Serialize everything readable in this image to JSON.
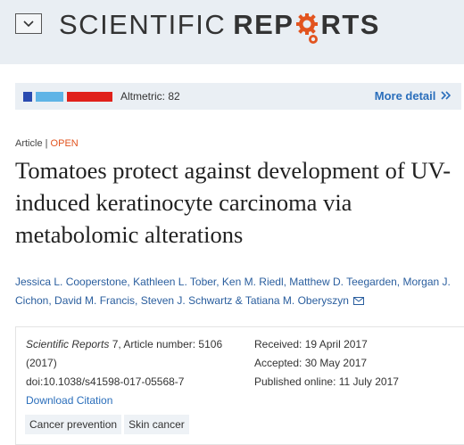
{
  "header": {
    "menu_icon": "chevron-down-icon",
    "logo_text_1": "SCIENTIFIC",
    "logo_text_2": "REP",
    "logo_text_3": "RTS"
  },
  "altmetric": {
    "label": "Altmetric: 82",
    "more_label": "More detail",
    "more_icon": "double-chevron-right-icon",
    "colors": [
      "#2a4bb0",
      "#5fb4e6",
      "#e0211b"
    ]
  },
  "article": {
    "type": "Article",
    "separator": "|",
    "access": "OPEN",
    "title": "Tomatoes protect against development of UV-induced keratinocyte carcinoma via metabolomic alterations",
    "authors_line1": "Jessica L. Cooperstone, Kathleen L. Tober, Ken M. Riedl, Matthew D. Teegarden, Morgan J.",
    "authors_line2": "Cichon, David M. Francis, Steven J. Schwartz & Tatiana M. Oberyszyn",
    "mail_icon": "envelope-icon"
  },
  "citation": {
    "journal": "Scientific Reports",
    "volume": " 7",
    "article_number": ", Article number: 5106",
    "year": "(2017)",
    "doi": "doi:10.1038/s41598-017-05568-7",
    "download": "Download Citation"
  },
  "dates": {
    "received_label": "Received:",
    "received": "19 April 2017",
    "accepted_label": "Accepted:",
    "accepted": "30 May 2017",
    "published_label": "Published online:",
    "published": "11 July 2017"
  },
  "tags": [
    "Cancer prevention",
    "Skin cancer"
  ]
}
